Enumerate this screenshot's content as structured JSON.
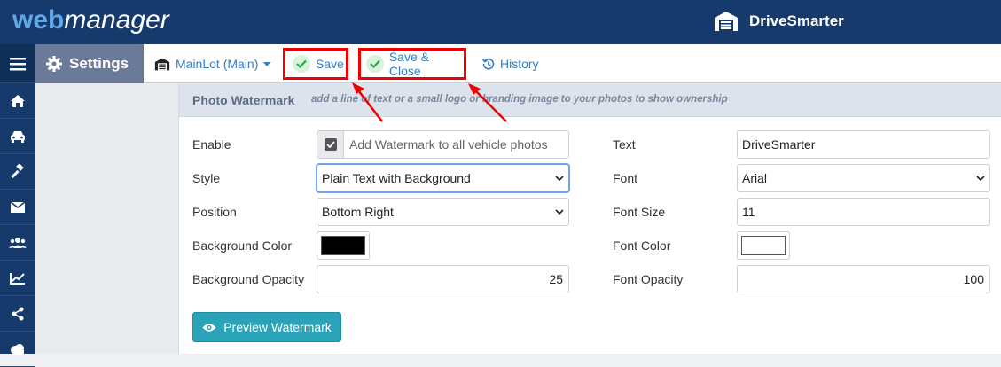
{
  "app": {
    "logo_web": "web",
    "logo_manager": "manager",
    "dealer_name": "DriveSmarter"
  },
  "sidebar": {
    "items": [
      {
        "icon": "menu-icon"
      },
      {
        "icon": "home-icon"
      },
      {
        "icon": "car-icon"
      },
      {
        "icon": "gavel-icon"
      },
      {
        "icon": "envelope-icon"
      },
      {
        "icon": "users-icon"
      },
      {
        "icon": "chart-icon"
      },
      {
        "icon": "share-icon"
      },
      {
        "icon": "cloud-icon"
      }
    ]
  },
  "header": {
    "settings_label": "Settings"
  },
  "toolbar": {
    "lot_label": "MainLot (Main)",
    "save_label": "Save",
    "save_close_label": "Save & Close",
    "history_label": "History"
  },
  "section": {
    "title": "Photo Watermark",
    "description": "add a line of text or a small logo or branding image to your photos to show ownership"
  },
  "form": {
    "enable": {
      "label": "Enable",
      "checked": true,
      "text": "Add Watermark to all vehicle photos"
    },
    "style": {
      "label": "Style",
      "value": "Plain Text with Background"
    },
    "position": {
      "label": "Position",
      "value": "Bottom Right"
    },
    "bg_color": {
      "label": "Background Color",
      "value": "#000000"
    },
    "bg_opacity": {
      "label": "Background Opacity",
      "value": "25"
    },
    "text": {
      "label": "Text",
      "value": "DriveSmarter"
    },
    "font": {
      "label": "Font",
      "value": "Arial"
    },
    "font_size": {
      "label": "Font Size",
      "value": "11"
    },
    "font_color": {
      "label": "Font Color",
      "value": "#ffffff"
    },
    "font_opacity": {
      "label": "Font Opacity",
      "value": "100"
    }
  },
  "preview_button": {
    "label": "Preview Watermark"
  },
  "colors": {
    "nav_bg": "#163a6b",
    "link": "#2f7fc8",
    "annotation": "#e00000",
    "preview_btn": "#2aa3b8"
  }
}
